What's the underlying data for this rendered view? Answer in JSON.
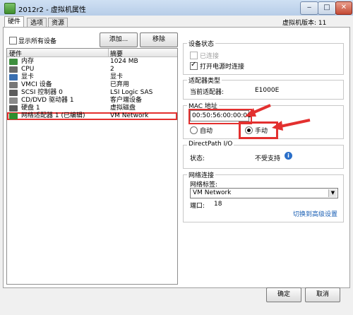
{
  "window": {
    "title": "2012r2 - 虚拟机属性",
    "min_glyph": "‒",
    "max_glyph": "□",
    "close_glyph": "✕"
  },
  "tabs": [
    "硬件",
    "选项",
    "资源"
  ],
  "version_label": "虚拟机版本: 11",
  "toolbar": {
    "show_all_devices": "显示所有设备",
    "add_label": "添加...",
    "remove_label": "移除"
  },
  "hardware": {
    "col_hardware": "硬件",
    "col_summary": "摘要",
    "rows": [
      {
        "name": "内存",
        "summary": "1024 MB",
        "icon": "memory-icon",
        "color": "#3f8f3f"
      },
      {
        "name": "CPU",
        "summary": "2",
        "icon": "cpu-icon",
        "color": "#6a6a6a"
      },
      {
        "name": "显卡",
        "summary": "显卡",
        "icon": "display-icon",
        "color": "#3a6fb0"
      },
      {
        "name": "VMCI 设备",
        "summary": "已弃用",
        "icon": "vmci-icon",
        "color": "#777777"
      },
      {
        "name": "SCSI 控制器 0",
        "summary": "LSI Logic SAS",
        "icon": "scsi-icon",
        "color": "#5c5c5c"
      },
      {
        "name": "CD/DVD 驱动器 1",
        "summary": "客户端设备",
        "icon": "cdrom-icon",
        "color": "#8a8a8a"
      },
      {
        "name": "硬盘 1",
        "summary": "虚拟磁盘",
        "icon": "disk-icon",
        "color": "#5a5a5a"
      },
      {
        "name": "网络适配器 1 (已编辑)",
        "summary": "VM Network",
        "icon": "network-icon",
        "color": "#2e8f2e"
      }
    ]
  },
  "device_status": {
    "title": "设备状态",
    "connected": "已连接",
    "connect_on_power": "打开电源时连接"
  },
  "adapter_type": {
    "title": "适配器类型",
    "label": "当前适配器:",
    "value": "E1000E"
  },
  "mac": {
    "title": "MAC 地址",
    "value": "00:50:56:00:00:01",
    "auto": "自动",
    "manual": "手动"
  },
  "directpath": {
    "title": "DirectPath I/O",
    "status_label": "状态:",
    "status_value": "不受支持"
  },
  "network": {
    "title": "网络连接",
    "label_text": "网络标签:",
    "selected": "VM Network",
    "port_label": "端口:",
    "port_value": "18",
    "advanced_link": "切换到高级设置"
  },
  "footer": {
    "ok": "确定",
    "cancel": "取消"
  },
  "colors": {
    "highlight": "#e3302f",
    "link": "#1a5fb4"
  }
}
